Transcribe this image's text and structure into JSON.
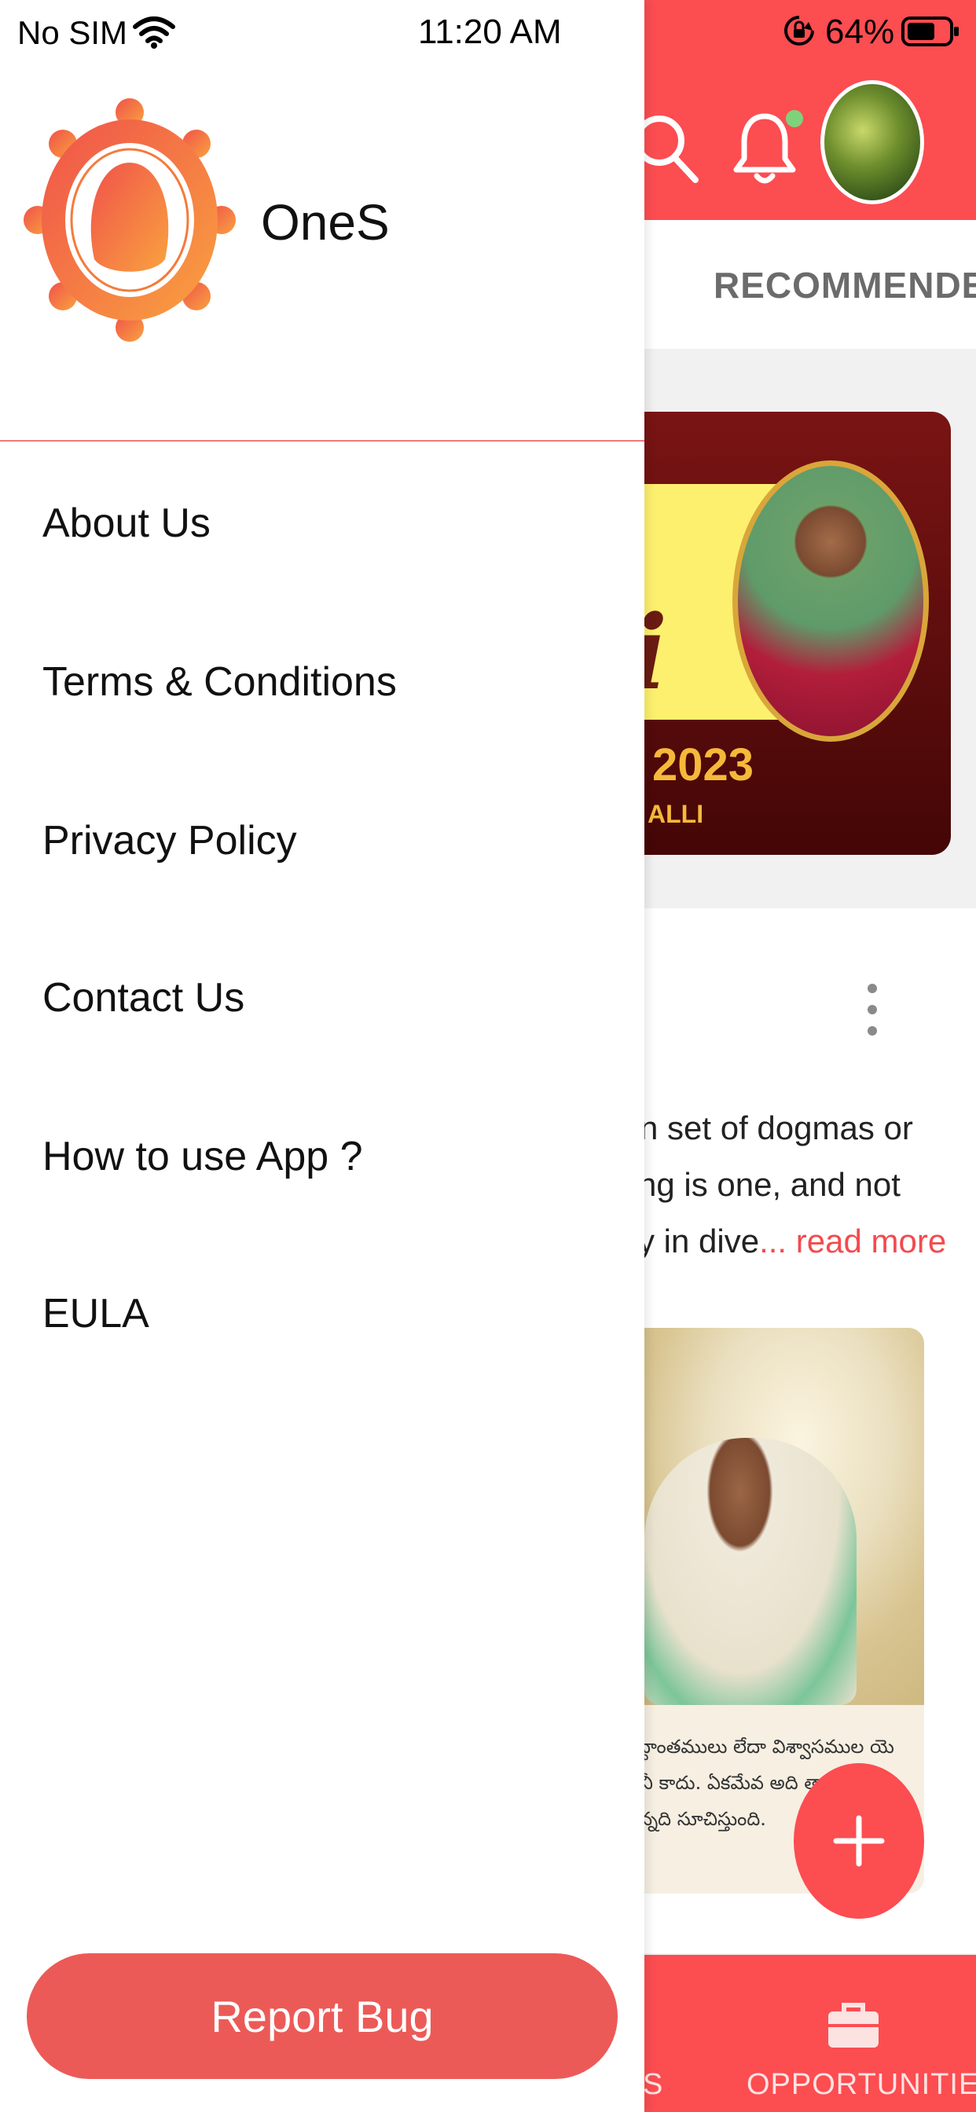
{
  "status_bar": {
    "carrier": "No SIM",
    "time": "11:20 AM",
    "battery": "64%"
  },
  "drawer": {
    "app_name": "OneS",
    "menu": [
      {
        "label": "About Us"
      },
      {
        "label": "Terms & Conditions"
      },
      {
        "label": "Privacy Policy"
      },
      {
        "label": "Contact Us"
      },
      {
        "label": "How to use App ?"
      },
      {
        "label": "EULA"
      }
    ],
    "report_bug_label": "Report Bug"
  },
  "background_app": {
    "tab_label": "RECOMMENDED",
    "banner": {
      "letter": "i",
      "year": "2023",
      "subtitle": "ALLI"
    },
    "post": {
      "text_line_1": "n set of dogmas or",
      "text_line_2": "ng is one, and not",
      "text_line_3": "y in dive",
      "read_more": "... read more",
      "image_caption": "సిద్ధాంతములు లేదా విశ్వాసముల యె కానీ కాదు. ఏకమేవ అది తా ఒక్కటే అన్నది సూచిస్తుంది."
    },
    "bottom_nav": {
      "partial_label": "S",
      "opportunities_label": "OPPORTUNITIES"
    }
  },
  "colors": {
    "brand_red": "#fc4d51",
    "report_bug_bg": "#ec5a57",
    "logo_orange": "#f47b3b",
    "divider": "#f07a7c"
  },
  "icons": [
    "wifi-icon",
    "rotation-lock-icon",
    "battery-icon",
    "search-icon",
    "bell-icon",
    "more-vertical-icon",
    "plus-icon",
    "briefcase-icon",
    "app-logo"
  ]
}
